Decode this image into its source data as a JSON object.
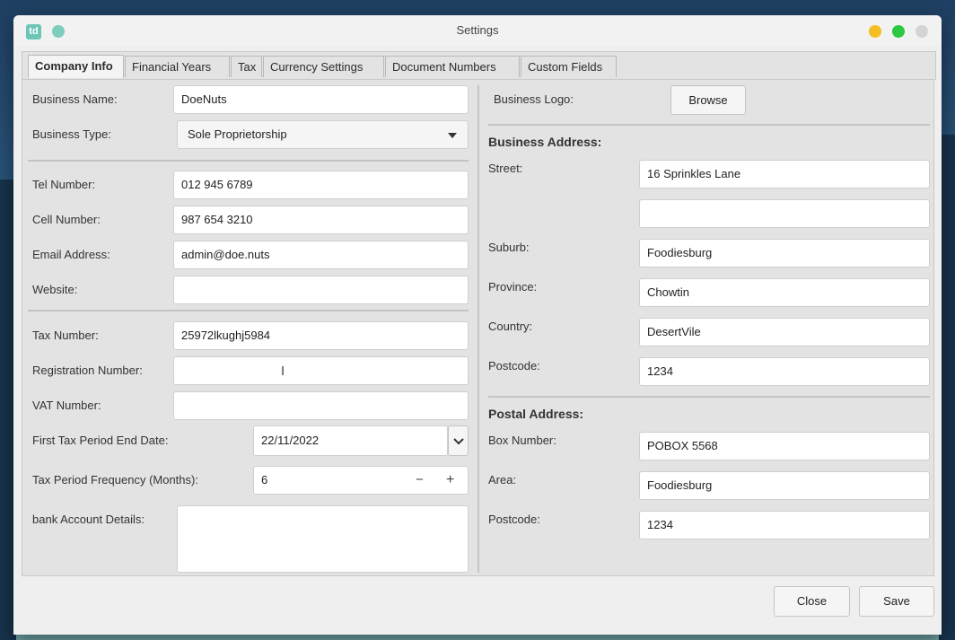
{
  "window": {
    "title": "Settings",
    "app_icon": "td"
  },
  "colors": {
    "close": "#d4d4d4",
    "maximize": "#2bc840",
    "minimize": "#f4be22",
    "pin": "#7fcdbd"
  },
  "tabs": [
    "Company Info",
    "Financial Years",
    "Tax",
    "Currency Settings",
    "Document Numbers",
    "Custom Fields"
  ],
  "left": {
    "business_name": {
      "label": "Business Name:",
      "value": "DoeNuts"
    },
    "business_type": {
      "label": "Business Type:",
      "value": "Sole Proprietorship"
    },
    "tel": {
      "label": "Tel Number:",
      "value": "012 945 6789"
    },
    "cell": {
      "label": "Cell Number:",
      "value": "987 654 3210"
    },
    "email": {
      "label": "Email Address:",
      "value": "admin@doe.nuts"
    },
    "website": {
      "label": "Website:",
      "value": ""
    },
    "tax_number": {
      "label": "Tax Number:",
      "value": "25972lkughj5984"
    },
    "registration": {
      "label": "Registration Number:",
      "value": ""
    },
    "vat": {
      "label": "VAT Number:",
      "value": ""
    },
    "first_tax": {
      "label": "First Tax Period End Date:",
      "value": "22/11/2022"
    },
    "frequency": {
      "label": "Tax Period Frequency (Months):",
      "value": "6",
      "minus": "−",
      "plus": "+"
    },
    "bank": {
      "label": "bank Account Details:",
      "value": ""
    }
  },
  "right": {
    "logo": {
      "label": "Business Logo:",
      "button": "Browse"
    },
    "business_address": {
      "heading": "Business Address:",
      "street_label": "Street:",
      "street1": "16 Sprinkles Lane",
      "street2": "",
      "suburb_label": "Suburb:",
      "suburb": "Foodiesburg",
      "province_label": "Province:",
      "province": "Chowtin",
      "country_label": "Country:",
      "country": "DesertVile",
      "postcode_label": "Postcode:",
      "postcode": "1234"
    },
    "postal_address": {
      "heading": "Postal Address:",
      "box_label": "Box Number:",
      "box": "POBOX 5568",
      "area_label": "Area:",
      "area": "Foodiesburg",
      "postcode_label": "Postcode:",
      "postcode": "1234"
    }
  },
  "footer": {
    "close": "Close",
    "save": "Save"
  }
}
